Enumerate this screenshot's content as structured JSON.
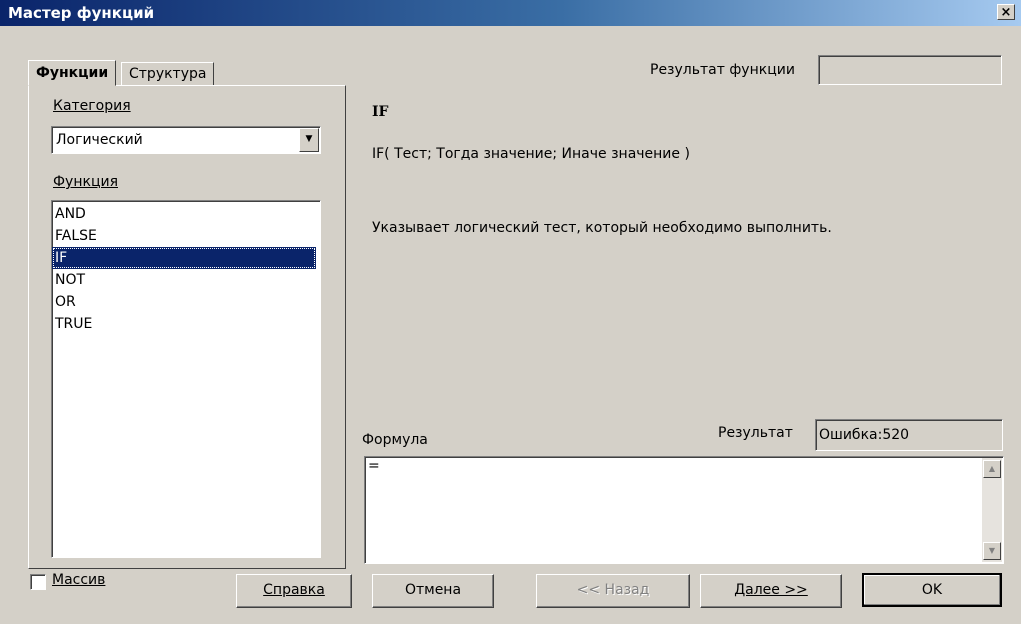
{
  "window": {
    "title": "Мастер функций",
    "close_glyph": "×"
  },
  "tabs": [
    {
      "label": "Функции",
      "active": true
    },
    {
      "label": "Структура",
      "active": false
    }
  ],
  "left_panel": {
    "category_label": "Категория",
    "category_value": "Логический",
    "function_label": "Функция",
    "functions": [
      "AND",
      "FALSE",
      "IF",
      "NOT",
      "OR",
      "TRUE"
    ],
    "selected_function": "IF"
  },
  "right_panel": {
    "function_result_label": "Результат функции",
    "function_result_value": "",
    "function_name": "IF",
    "function_signature": "IF( Тест; Тогда значение; Иначе значение )",
    "function_description": "Указывает логический тест, который необходимо выполнить.",
    "formula_label": "Формула",
    "result_label": "Результат",
    "result_value": "Ошибка:520",
    "formula_value": "="
  },
  "footer": {
    "array_label": "Массив",
    "array_checked": false,
    "buttons": {
      "help": "Справка",
      "cancel": "Отмена",
      "back": "<< Назад",
      "next": "Далее >>",
      "ok": "OK"
    }
  },
  "icons": {
    "dropdown": "chevron-down-icon",
    "scroll_up": "scroll-up-icon",
    "scroll_down": "scroll-down-icon",
    "close": "close-icon"
  },
  "colors": {
    "title_bar": "#0a246a",
    "selection": "#0a246a",
    "dialog_bg": "#d4d0c8"
  }
}
